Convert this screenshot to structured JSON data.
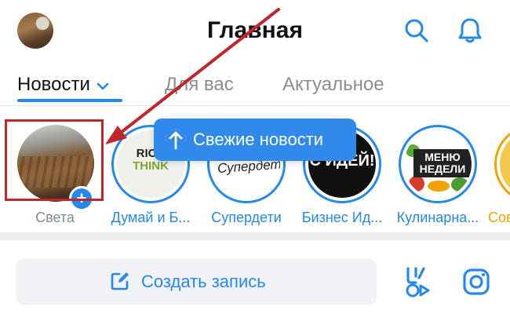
{
  "header": {
    "title": "Главная"
  },
  "tabs": [
    {
      "label": "Новости"
    },
    {
      "label": "Для вас"
    },
    {
      "label": "Актуальное"
    }
  ],
  "stories": [
    {
      "label": "Света"
    },
    {
      "label": "Думай и Б...",
      "thumb_text_1": "RICH",
      "thumb_text_2": "THINK"
    },
    {
      "label": "Супердети",
      "thumb_text": "Супердети"
    },
    {
      "label": "Бизнес Ид...",
      "thumb_text": "С ИДЕЙ!"
    },
    {
      "label": "Кулинарна...",
      "thumb_text": "МЕНЮ НЕДЕЛИ"
    },
    {
      "label": "Сов"
    }
  ],
  "fresh_news": {
    "label": "Свежие новости"
  },
  "composer": {
    "create_label": "Создать запись"
  },
  "colors": {
    "accent": "#2688eb",
    "highlight": "#c0272d"
  }
}
